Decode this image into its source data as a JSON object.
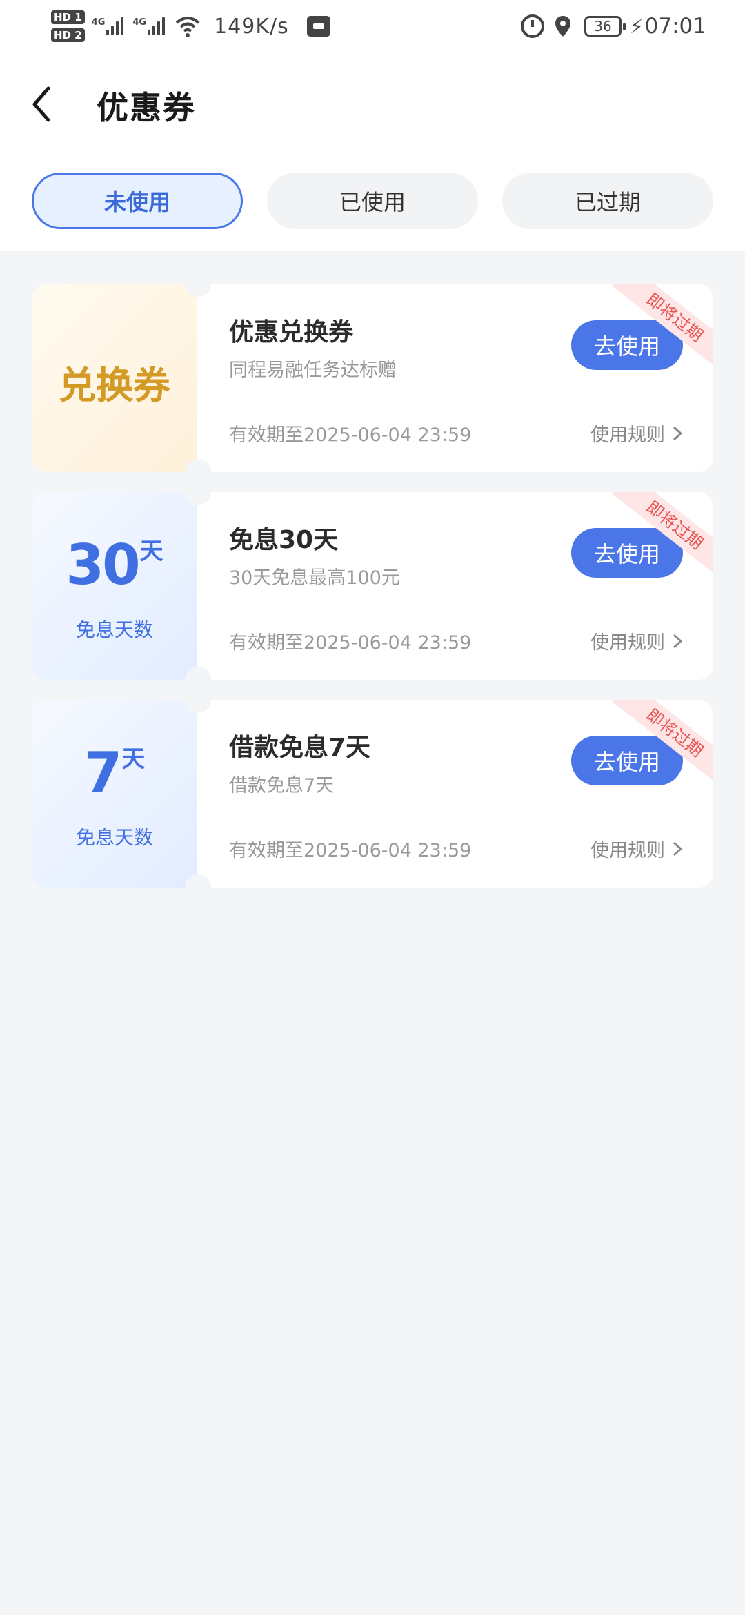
{
  "status_bar": {
    "hd1": "HD 1",
    "hd2": "HD 2",
    "signal1_gen": "4G",
    "signal2_gen": "4G",
    "speed": "149K/s",
    "battery": "36",
    "time": "07:01"
  },
  "header": {
    "title": "优惠券"
  },
  "tabs": [
    {
      "label": "未使用",
      "active": true
    },
    {
      "label": "已使用",
      "active": false
    },
    {
      "label": "已过期",
      "active": false
    }
  ],
  "coupons": [
    {
      "stub_text": "兑换券",
      "title": "优惠兑换券",
      "subtitle": "同程易融任务达标赠",
      "expiry": "有效期至2025-06-04 23:59",
      "rule_label": "使用规则",
      "button_label": "去使用",
      "ribbon": "即将过期"
    },
    {
      "days_num": "30",
      "days_unit": "天",
      "days_label": "免息天数",
      "title": "免息30天",
      "subtitle": "30天免息最高100元",
      "expiry": "有效期至2025-06-04 23:59",
      "rule_label": "使用规则",
      "button_label": "去使用",
      "ribbon": "即将过期"
    },
    {
      "days_num": "7",
      "days_unit": "天",
      "days_label": "免息天数",
      "title": "借款免息7天",
      "subtitle": "借款免息7天",
      "expiry": "有效期至2025-06-04 23:59",
      "rule_label": "使用规则",
      "button_label": "去使用",
      "ribbon": "即将过期"
    }
  ],
  "colors": {
    "accent": "#4b76e8",
    "gold": "#d49a26",
    "ribbon_text": "#e85555",
    "page_bg": "#f4f5f7"
  },
  "icons": {
    "back": "chevron-left-icon",
    "rule_arrow": "chevron-right-icon",
    "alarm": "alarm-icon",
    "location": "location-pin-icon",
    "wifi": "wifi-icon",
    "battery": "battery-icon",
    "charging": "lightning-icon"
  }
}
